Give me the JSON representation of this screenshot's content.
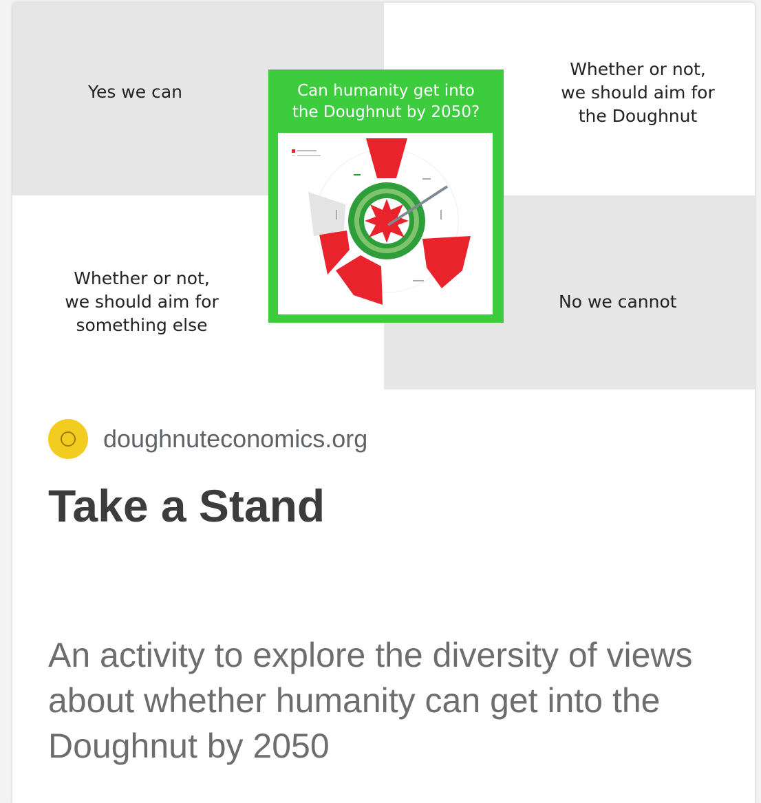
{
  "preview": {
    "top_left": "Yes we can",
    "top_right": "Whether or not,\nwe should aim for\nthe Doughnut",
    "bottom_left": "Whether or not,\nwe should aim for\nsomething else",
    "bottom_right": "No we cannot",
    "poster_title": "Can humanity get into\nthe Doughnut by 2050?"
  },
  "link": {
    "source": "doughnuteconomics.org",
    "title": "Take a Stand",
    "description": "An activity to explore the diversity of views about whether humanity can get into the Doughnut by 2050"
  },
  "colors": {
    "poster_green": "#3dcc3d",
    "doughnut_green": "#2e9e3a",
    "overshoot_red": "#e8232b",
    "quadrant_gray": "#e6e6e6",
    "source_icon": "#f2cc1e"
  },
  "icons": {
    "source": "site-favicon-icon"
  }
}
